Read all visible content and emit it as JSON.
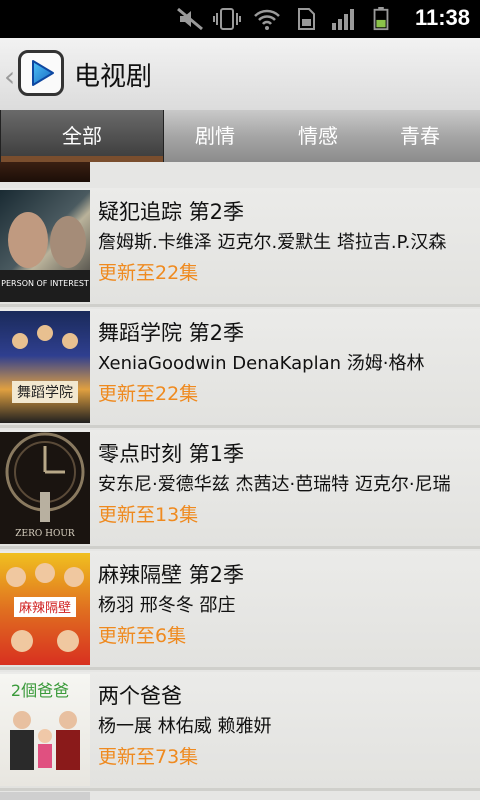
{
  "status_bar": {
    "time": "11:38",
    "icons": [
      "mute-icon",
      "vibrate-icon",
      "wifi-icon",
      "sim-icon",
      "signal-icon",
      "battery-icon"
    ]
  },
  "header": {
    "title": "电视剧",
    "back_icon": "chevron-left-icon",
    "logo_icon": "play-icon"
  },
  "tabs": [
    {
      "label": "全部",
      "active": true
    },
    {
      "label": "剧情",
      "active": false
    },
    {
      "label": "情感",
      "active": false
    },
    {
      "label": "青春",
      "active": false
    }
  ],
  "items": [
    {
      "title": "疑犯追踪 第2季",
      "cast": "詹姆斯.卡维泽 迈克尔.爱默生 塔拉吉.P.汉森",
      "update": "更新至22集",
      "poster_text": "PERSON OF INTEREST"
    },
    {
      "title": "舞蹈学院 第2季",
      "cast": "XeniaGoodwin DenaKaplan 汤姆·格林",
      "update": "更新至22集",
      "poster_text": "舞蹈学院"
    },
    {
      "title": "零点时刻 第1季",
      "cast": "安东尼·爱德华兹 杰茜达·芭瑞特 迈克尔·尼瑞",
      "update": "更新至13集",
      "poster_text": "ZERO HOUR"
    },
    {
      "title": "麻辣隔壁 第2季",
      "cast": "杨羽 邢冬冬 邵庄",
      "update": "更新至6集",
      "poster_text": "麻辣隔壁"
    },
    {
      "title": "两个爸爸",
      "cast": "杨一展 林佑威 赖雅妍",
      "update": "更新至73集",
      "poster_text": "2個爸爸"
    }
  ],
  "colors": {
    "accent_orange": "#ef8a1f",
    "tab_active_underline": "#7a4e2e"
  }
}
